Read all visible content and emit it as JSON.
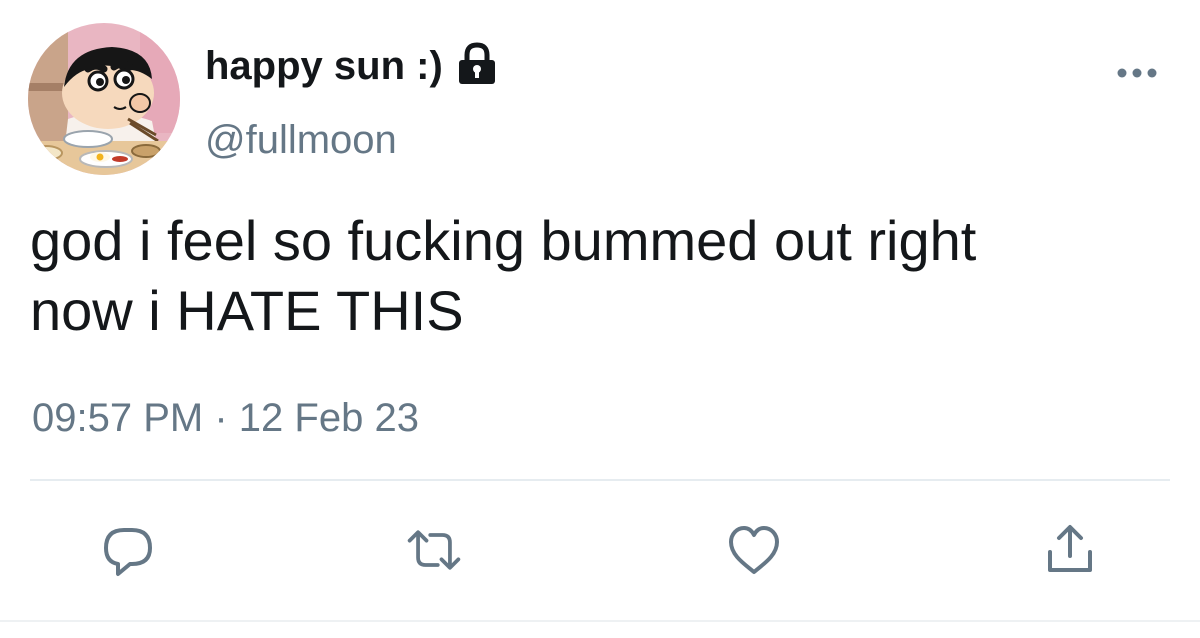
{
  "author": {
    "display_name": "happy sun :)",
    "username": "@fullmoon",
    "protected": true,
    "avatar": "cartoon-boy-eating-avatar"
  },
  "tweet": {
    "text_lines": [
      "god i feel so fucking bummed out right",
      "now i HATE THIS"
    ],
    "time": "09:57 PM",
    "separator": "·",
    "date": "12 Feb 23"
  },
  "icons": {
    "more": "more-options-icon",
    "lock": "lock-icon",
    "reply": "reply-icon",
    "retweet": "retweet-icon",
    "like": "heart-icon",
    "share": "share-icon"
  },
  "colors": {
    "text": "#14171a",
    "secondary": "#657786",
    "divider": "#e6ecf0"
  }
}
